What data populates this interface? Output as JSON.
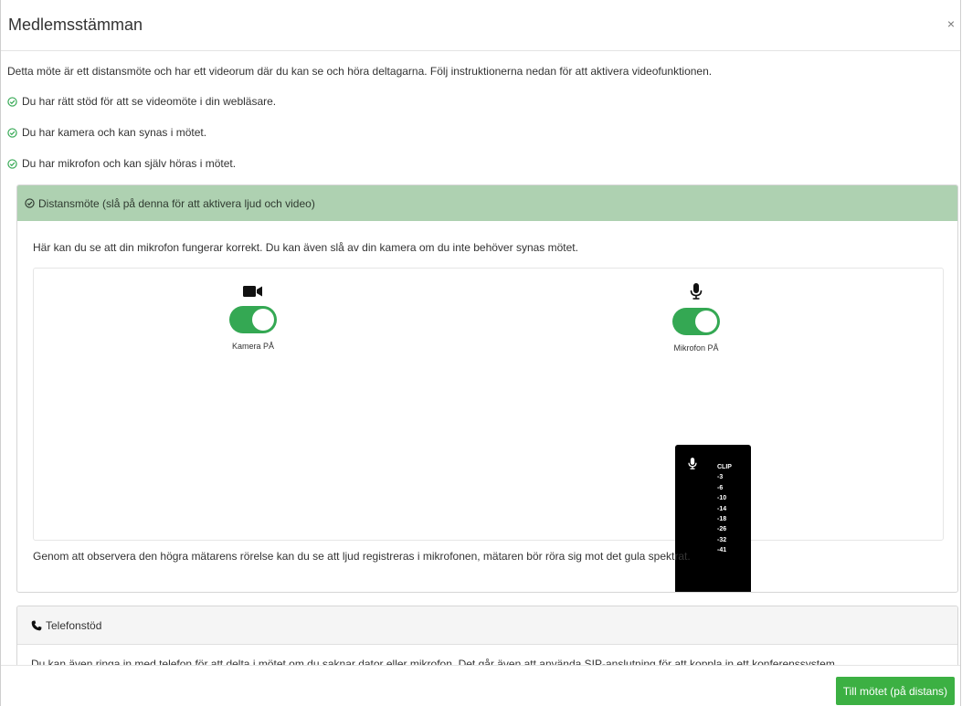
{
  "modal": {
    "title": "Medlemsstämman",
    "close": "×"
  },
  "intro": "Detta möte är ett distansmöte och har ett videorum där du kan se och höra deltagarna. Följ instruktionerna nedan för att aktivera videofunktionen.",
  "checks": [
    "Du har rätt stöd för att se videomöte i din webläsare.",
    "Du har kamera och kan synas i mötet.",
    "Du har mikrofon och kan själv höras i mötet."
  ],
  "distance_panel": {
    "heading": "Distansmöte (slå på denna för att aktivera ljud och video)",
    "description": "Här kan du se att din mikrofon fungerar korrekt. Du kan även slå av din kamera om du inte behöver synas mötet.",
    "camera_label": "Kamera PÅ",
    "mic_label": "Mikrofon PÅ",
    "meter_scale": [
      "CLIP",
      "-3",
      "-6",
      "-10",
      "-14",
      "-18",
      "-26",
      "-32",
      "-41"
    ],
    "footer": "Genom att observera den högra mätarens rörelse kan du se att ljud registreras i mikrofonen, mätaren bör röra sig mot det gula spektrat."
  },
  "phone_panel": {
    "heading": "Telefonstöd",
    "body": "Du kan även ringa in med telefon för att delta i mötet om du saknar dator eller mikrofon. Det går även att använda SIP-anslutning för att koppla in ett konferenssystem."
  },
  "footer": {
    "go_button": "Till mötet (på distans)"
  },
  "colors": {
    "accent_green": "#3cb043",
    "toggle_on": "#34a853",
    "panel_heading": "#aed1b1",
    "check_icon": "#34a853"
  }
}
